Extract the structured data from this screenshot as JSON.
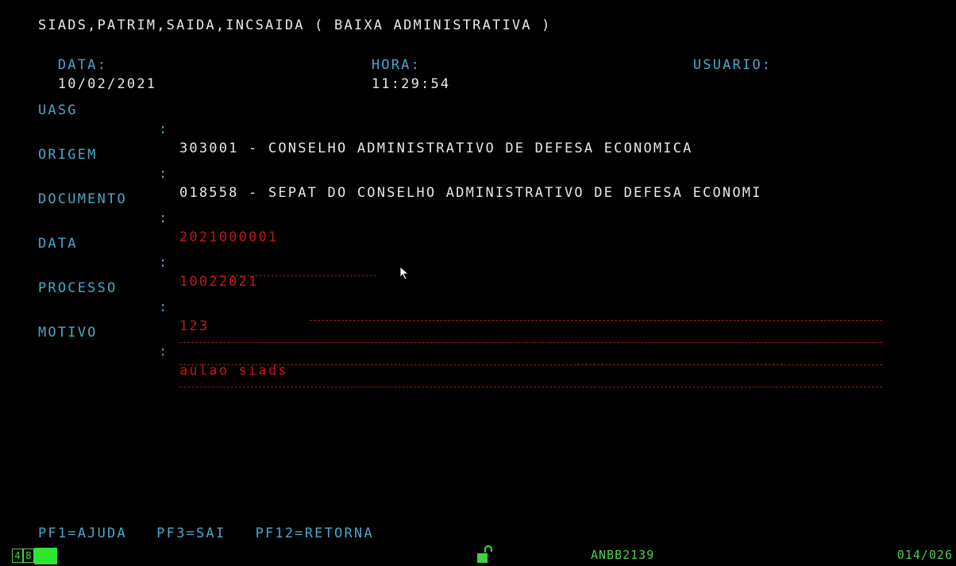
{
  "header": {
    "title": "SIADS,PATRIM,SAIDA,INCSAIDA ( BAIXA ADMINISTRATIVA )",
    "date_label": "DATA:",
    "date_value": "10/02/2021",
    "time_label": "HORA:",
    "time_value": "11:29:54",
    "user_label": "USUARIO:",
    "user_value": ""
  },
  "fields": {
    "uasg": {
      "label": "UASG",
      "value": "303001 - CONSELHO ADMINISTRATIVO DE DEFESA ECONOMICA"
    },
    "origem": {
      "label": "ORIGEM",
      "value": "018558 - SEPAT DO CONSELHO ADMINISTRATIVO DE DEFESA ECONOMI"
    },
    "documento": {
      "label": "DOCUMENTO",
      "value": "2021000001"
    },
    "data": {
      "label": "DATA",
      "value": "10022021"
    },
    "processo": {
      "label": "PROCESSO",
      "value": "123"
    },
    "motivo": {
      "label": "MOTIVO",
      "value": "aulao siads"
    }
  },
  "colon": ":",
  "footer": {
    "pf_keys": "PF1=AJUDA   PF3=SAI   PF12=RETORNA"
  },
  "status_bar": {
    "session_indicator": "4",
    "session_letter": "B",
    "terminal_id": "ANBB2139",
    "cursor_position": "014/026",
    "lock_icon": "unlocked-padlock-icon"
  },
  "colors": {
    "background": "#000000",
    "label": "#4aa7c9",
    "input": "#c01818",
    "title": "#e8e8e8",
    "status": "#4ccf4c"
  }
}
